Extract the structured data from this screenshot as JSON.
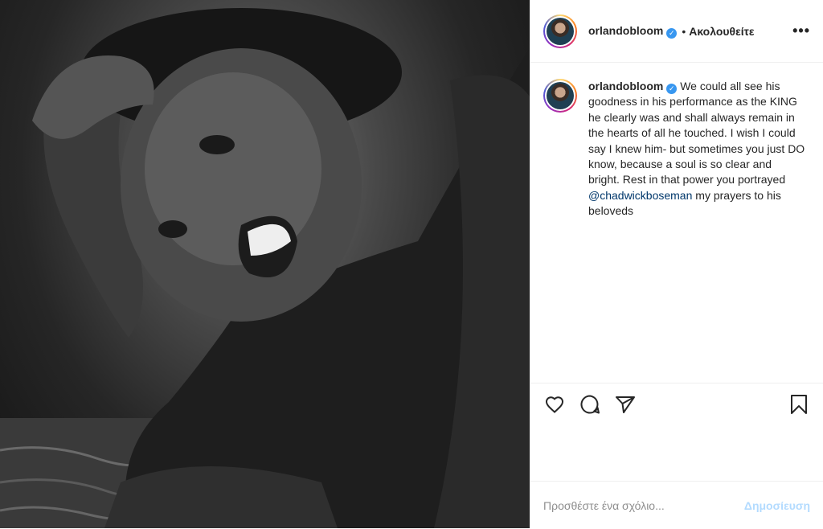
{
  "post": {
    "author": {
      "username": "orlandobloom",
      "verified": true,
      "avatar_icon": "profile-avatar"
    },
    "header": {
      "separator": "•",
      "follow_label": "Ακολουθείτε",
      "more_label": "•••"
    },
    "photo": {
      "description_icon": "portrait-photo"
    },
    "caption": {
      "username": "orlandobloom",
      "text_before": "We could all see his goodness in his performance as the KING he clearly was and shall always remain in the hearts of all he touched. I wish I could say I knew him- but sometimes you just DO know, because a soul is so clear and bright. Rest in that power you portrayed ",
      "mention": "@chadwickboseman",
      "text_after": " my prayers to his beloveds"
    },
    "actions": {
      "like_icon": "heart-icon",
      "comment_icon": "comment-bubble-icon",
      "share_icon": "paper-plane-icon",
      "save_icon": "bookmark-icon"
    },
    "comment": {
      "placeholder": "Προσθέστε ένα σχόλιο...",
      "publish_label": "Δημοσίευση"
    },
    "colors": {
      "link": "#00376b",
      "verified": "#3897f0",
      "publish_disabled": "#b3dbff",
      "border": "#efefef"
    }
  }
}
